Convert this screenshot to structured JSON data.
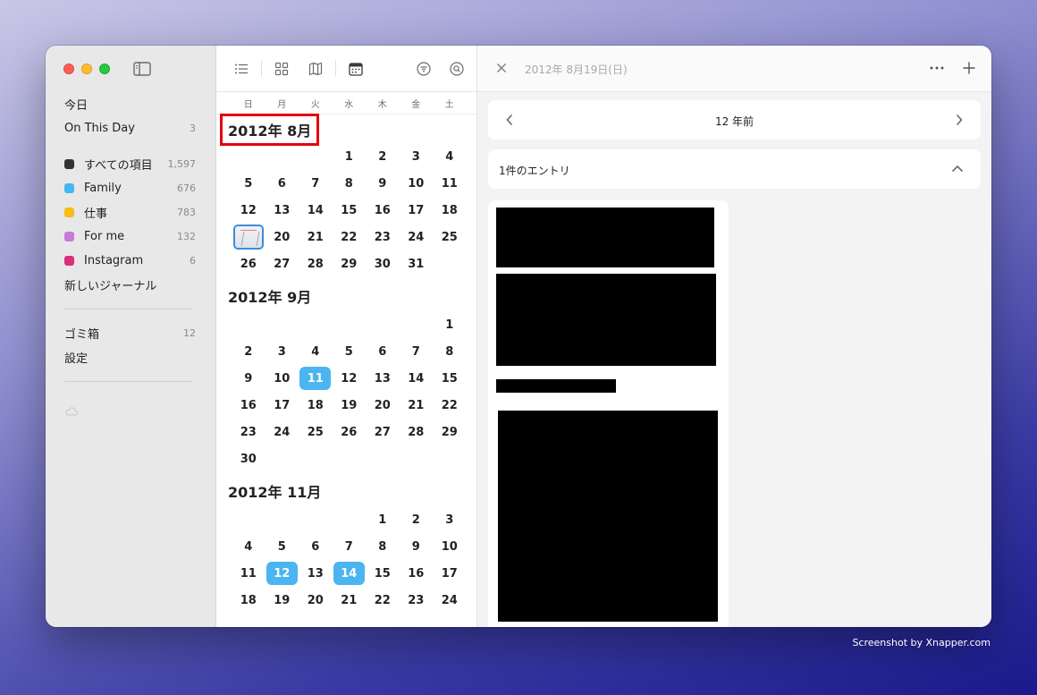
{
  "sidebar": {
    "top_items": [
      {
        "label": "今日",
        "count": ""
      },
      {
        "label": "On This Day",
        "count": "3"
      }
    ],
    "journals": [
      {
        "label": "すべての項目",
        "count": "1,597",
        "color": "#333333"
      },
      {
        "label": "Family",
        "count": "676",
        "color": "#45b6f2"
      },
      {
        "label": "仕事",
        "count": "783",
        "color": "#f6bf18"
      },
      {
        "label": "For me",
        "count": "132",
        "color": "#c77ad6"
      },
      {
        "label": "Instagram",
        "count": "6",
        "color": "#d8307a"
      }
    ],
    "new_journal": "新しいジャーナル",
    "trash": {
      "label": "ゴミ箱",
      "count": "12"
    },
    "settings": "設定"
  },
  "calendar": {
    "weekdays": [
      "日",
      "月",
      "火",
      "水",
      "木",
      "金",
      "土"
    ],
    "months": [
      {
        "title": "2012年 8月",
        "highlighted": true,
        "rows": [
          [
            "",
            "",
            "",
            "1",
            "2",
            "3",
            "4"
          ],
          [
            "5",
            "6",
            "7",
            "8",
            "9",
            "10",
            "11"
          ],
          [
            "12",
            "13",
            "14",
            "15",
            "16",
            "17",
            "18"
          ],
          [
            "19",
            "20",
            "21",
            "22",
            "23",
            "24",
            "25"
          ],
          [
            "26",
            "27",
            "28",
            "29",
            "30",
            "31",
            ""
          ]
        ],
        "selected": [],
        "thumbnail": [
          "19"
        ]
      },
      {
        "title": "2012年 9月",
        "highlighted": false,
        "rows": [
          [
            "",
            "",
            "",
            "",
            "",
            "",
            "1"
          ],
          [
            "2",
            "3",
            "4",
            "5",
            "6",
            "7",
            "8"
          ],
          [
            "9",
            "10",
            "11",
            "12",
            "13",
            "14",
            "15"
          ],
          [
            "16",
            "17",
            "18",
            "19",
            "20",
            "21",
            "22"
          ],
          [
            "23",
            "24",
            "25",
            "26",
            "27",
            "28",
            "29"
          ],
          [
            "30",
            "",
            "",
            "",
            "",
            "",
            ""
          ]
        ],
        "selected": [
          "11"
        ],
        "thumbnail": []
      },
      {
        "title": "2012年 11月",
        "highlighted": false,
        "rows": [
          [
            "",
            "",
            "",
            "",
            "1",
            "2",
            "3"
          ],
          [
            "4",
            "5",
            "6",
            "7",
            "8",
            "9",
            "10"
          ],
          [
            "11",
            "12",
            "13",
            "14",
            "15",
            "16",
            "17"
          ],
          [
            "18",
            "19",
            "20",
            "21",
            "22",
            "23",
            "24"
          ]
        ],
        "selected": [
          "12",
          "14"
        ],
        "thumbnail": []
      }
    ]
  },
  "detail": {
    "date_title": "2012年 8月19日(日)",
    "years_ago": "12 年前",
    "entries_count": "1件のエントリ"
  },
  "watermark": "Screenshot by Xnapper.com",
  "colors": {
    "accent": "#4ab5f0",
    "highlight_box": "#e3000f"
  }
}
